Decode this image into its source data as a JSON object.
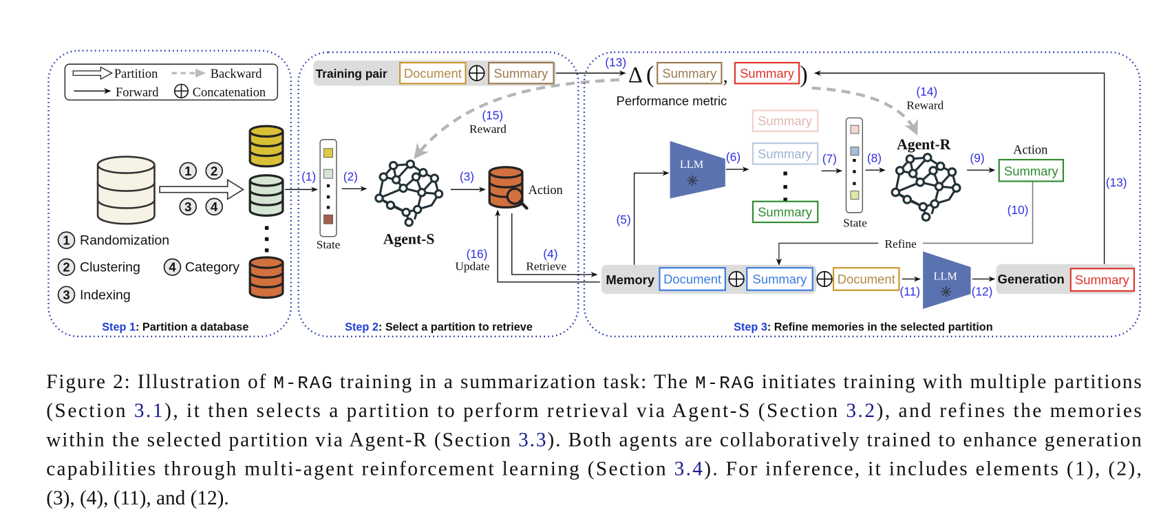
{
  "legend": {
    "partition": "Partition",
    "backward": "Backward",
    "forward": "Forward",
    "concatenation": "Concatenation"
  },
  "step1": {
    "title_prefix": "Step 1",
    "title": ": Partition a database",
    "methods": [
      {
        "num": "1",
        "label": "Randomization"
      },
      {
        "num": "2",
        "label": "Clustering"
      },
      {
        "num": "3",
        "label": "Indexing"
      },
      {
        "num": "4",
        "label": "Category"
      }
    ],
    "arrow_nums": [
      "1",
      "2",
      "3",
      "4"
    ],
    "partition_colors": [
      "#d9bf35",
      "#d4e6d3",
      "#d2703e"
    ]
  },
  "step2": {
    "title_prefix": "Step 2",
    "title": ": Select a partition to retrieve",
    "training_pair": "Training pair",
    "document": "Document",
    "summary": "Summary",
    "state_label": "State",
    "agent_label": "Agent-S",
    "action_label": "Action",
    "update_label": "Update",
    "retrieve_label": "Retrieve",
    "reward_label": "Reward",
    "nums": {
      "n1": "(1)",
      "n2": "(2)",
      "n3": "(3)",
      "n4": "(4)",
      "n15": "(15)",
      "n16": "(16)"
    },
    "state_colors": [
      "#e0c84a",
      "#d4e6d3",
      "#a0614a"
    ]
  },
  "step3": {
    "title_prefix": "Step 3",
    "title": ": Refine memories in the selected partition",
    "delta_symbol": "Δ",
    "metric_summary_a": "Summary",
    "metric_summary_b": "Summary",
    "performance_metric": "Performance metric",
    "llm_label": "LLM",
    "candidates": [
      "Summary",
      "Summary",
      "Summary"
    ],
    "state_label": "State",
    "agent_label": "Agent-R",
    "action_label": "Action",
    "action_summary": "Summary",
    "refine_label": "Refine",
    "reward_label": "Reward",
    "memory_label": "Memory",
    "memory_document": "Document",
    "memory_summary": "Summary",
    "input_document": "Document",
    "generation_label": "Generation",
    "generation_summary": "Summary",
    "nums": {
      "n5": "(5)",
      "n6": "(6)",
      "n7": "(7)",
      "n8": "(8)",
      "n9": "(9)",
      "n10": "(10)",
      "n11": "(11)",
      "n12": "(12)",
      "n13a": "(13)",
      "n13b": "(13)",
      "n14": "(14)"
    },
    "state_colors": [
      "#f3d6d2",
      "#a7bcd8",
      "#d9e8a6"
    ]
  },
  "colors": {
    "step_title_blue": "#1f3fd6",
    "number_blue": "#2f2fe0",
    "border_blue": "#1c2fa8",
    "doc_gold": "#c9962b",
    "summary_brown": "#9a7a50",
    "summary_red": "#e0342a",
    "summary_green": "#2e8b2e",
    "summary_blue": "#3b7ae0",
    "llm_fill": "#5a72b0"
  },
  "caption": {
    "lines": [
      [
        {
          "t": "Figure 2: Illustration of "
        },
        {
          "t": "M-RAG",
          "mono": true
        },
        {
          "t": " training in a summarization task: The "
        },
        {
          "t": "M-RAG",
          "mono": true
        },
        {
          "t": " initiates training with multiple partitions"
        }
      ],
      [
        {
          "t": "(Section "
        },
        {
          "t": "3.1",
          "ref": true
        },
        {
          "t": "), it then selects a partition to perform retrieval via Agent-S (Section "
        },
        {
          "t": "3.2",
          "ref": true
        },
        {
          "t": "), and refines the memories"
        }
      ],
      [
        {
          "t": "within the selected partition via Agent-R (Section "
        },
        {
          "t": "3.3",
          "ref": true
        },
        {
          "t": "). Both agents are collaboratively trained to enhance generation"
        }
      ],
      [
        {
          "t": "capabilities through multi-agent reinforcement learning (Section "
        },
        {
          "t": "3.4",
          "ref": true
        },
        {
          "t": "). For inference, it includes elements (1), (2),"
        }
      ],
      [
        {
          "t": "(3), (4), (11), and (12)."
        }
      ]
    ]
  }
}
